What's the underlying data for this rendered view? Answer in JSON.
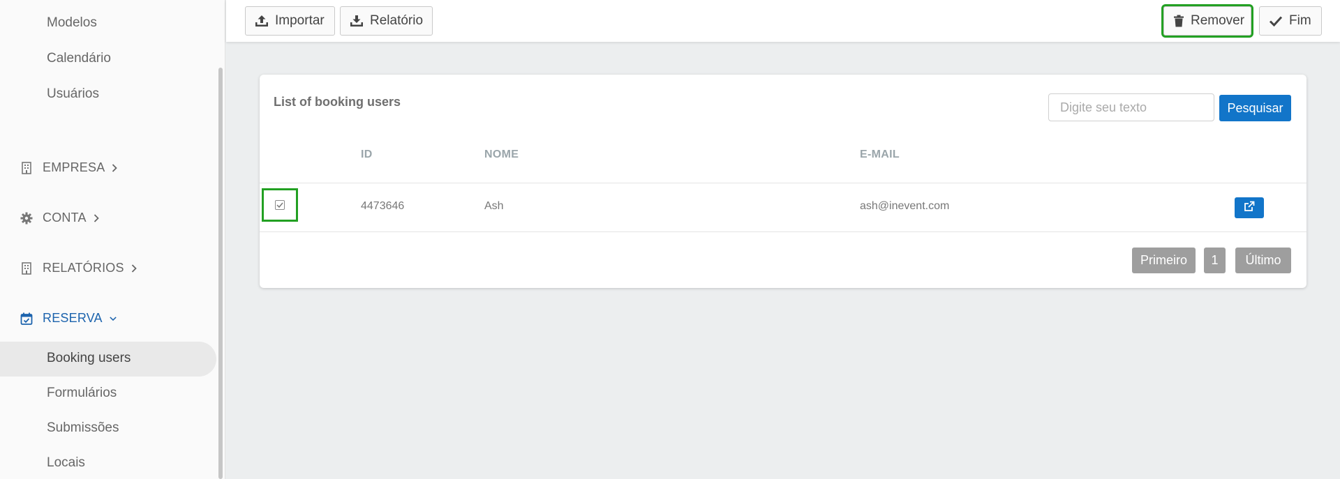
{
  "sidebar": {
    "top_items": [
      "Modelos",
      "Calendário",
      "Usuários"
    ],
    "groups": [
      {
        "label": "EMPRESA",
        "icon": "building-icon"
      },
      {
        "label": "CONTA",
        "icon": "gear-icon"
      },
      {
        "label": "RELATÓRIOS",
        "icon": "building-icon"
      },
      {
        "label": "RESERVA",
        "icon": "calendar-check-icon",
        "expanded": true
      }
    ],
    "reserva_items": [
      "Booking users",
      "Formulários",
      "Submissões",
      "Locais"
    ],
    "active_item": "Booking users"
  },
  "toolbar": {
    "import_label": "Importar",
    "report_label": "Relatório",
    "remove_label": "Remover",
    "finish_label": "Fim"
  },
  "card": {
    "title": "List of booking users",
    "search_placeholder": "Digite seu texto",
    "search_button": "Pesquisar",
    "columns": [
      "ID",
      "NOME",
      "E-MAIL"
    ],
    "rows": [
      {
        "id": "4473646",
        "name": "Ash",
        "email": "ash@inevent.com",
        "checked": true
      }
    ],
    "pagination": {
      "first": "Primeiro",
      "page": "1",
      "last": "Último"
    }
  },
  "colors": {
    "accent": "#1275c9",
    "active_nav": "#1c63ad",
    "highlight": "#22a022",
    "pagination": "#9e9e9e"
  }
}
